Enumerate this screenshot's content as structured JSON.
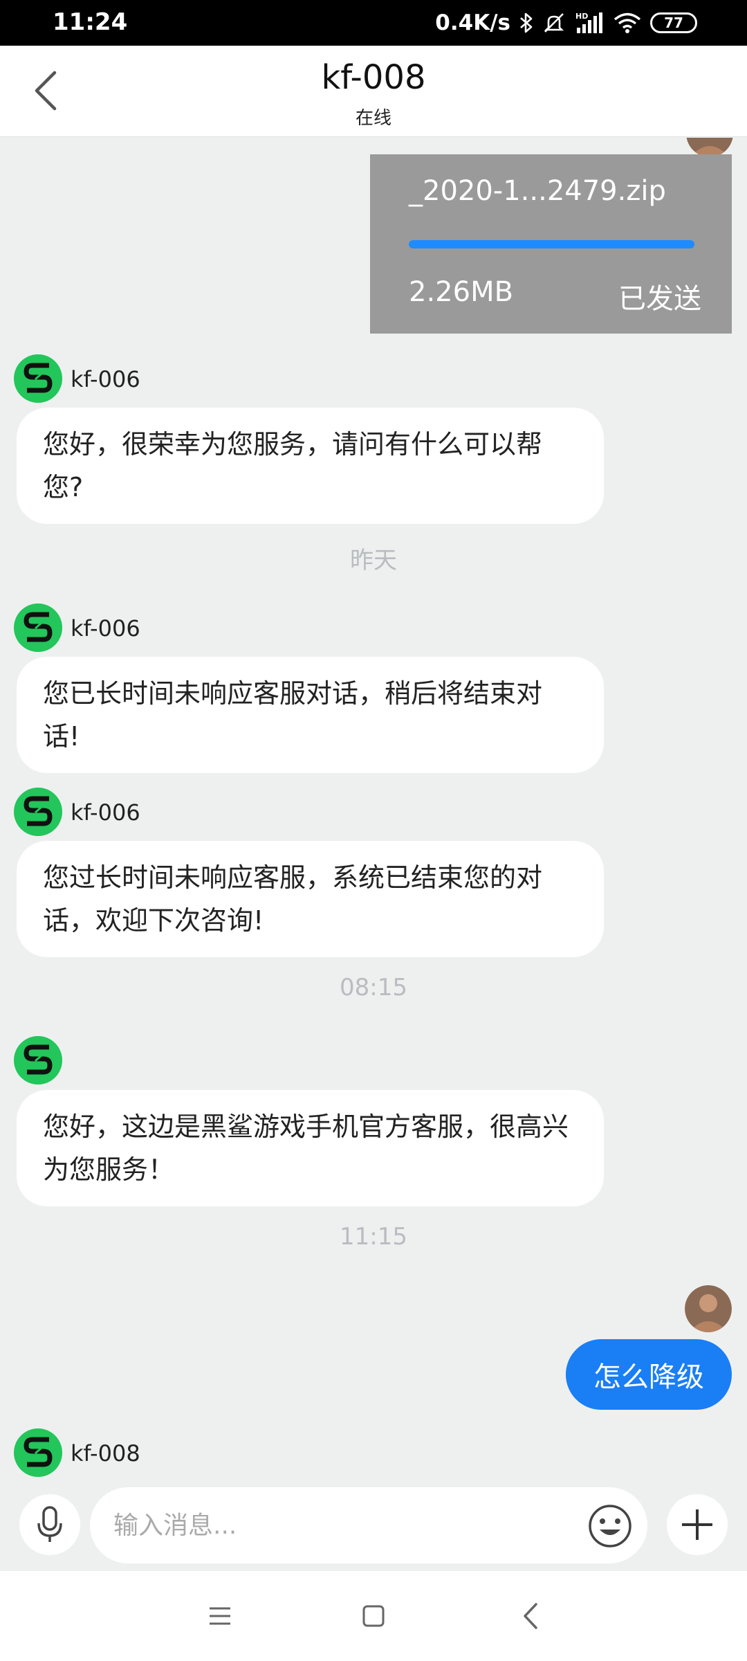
{
  "status_bar": {
    "time": "11:24",
    "network_speed": "0.4K/s",
    "battery": "77",
    "icons": [
      "bluetooth-icon",
      "mute-icon",
      "signal-icon",
      "wifi-icon",
      "battery-icon"
    ]
  },
  "header": {
    "title": "kf-008",
    "subtitle": "在线",
    "back_icon": "chevron-left-icon"
  },
  "messages": {
    "file": {
      "name": "_2020-1...2479.zip",
      "size": "2.26MB",
      "status": "已发送",
      "progress": 1.0
    },
    "m1": {
      "sender": "kf-006",
      "text": "您好，很荣幸为您服务，请问有什么可以帮您?"
    },
    "ts1": "昨天",
    "m2": {
      "sender": "kf-006",
      "text": "您已长时间未响应客服对话，稍后将结束对话!"
    },
    "m3": {
      "sender": "kf-006",
      "text": "您过长时间未响应客服，系统已结束您的对话，欢迎下次咨询!"
    },
    "ts2": "08:15",
    "m4": {
      "sender": "",
      "text": "您好，这边是黑鲨游戏手机官方客服，很高兴为您服务！"
    },
    "ts3": "11:15",
    "m5": {
      "text": "怎么降级"
    },
    "m6": {
      "sender": "kf-008"
    }
  },
  "input": {
    "placeholder": "输入消息..."
  },
  "colors": {
    "accent": "#1a7ef5",
    "agent_avatar": "#22c65a",
    "file_card": "#9a9a9a",
    "chat_bg": "#eef0f0"
  }
}
